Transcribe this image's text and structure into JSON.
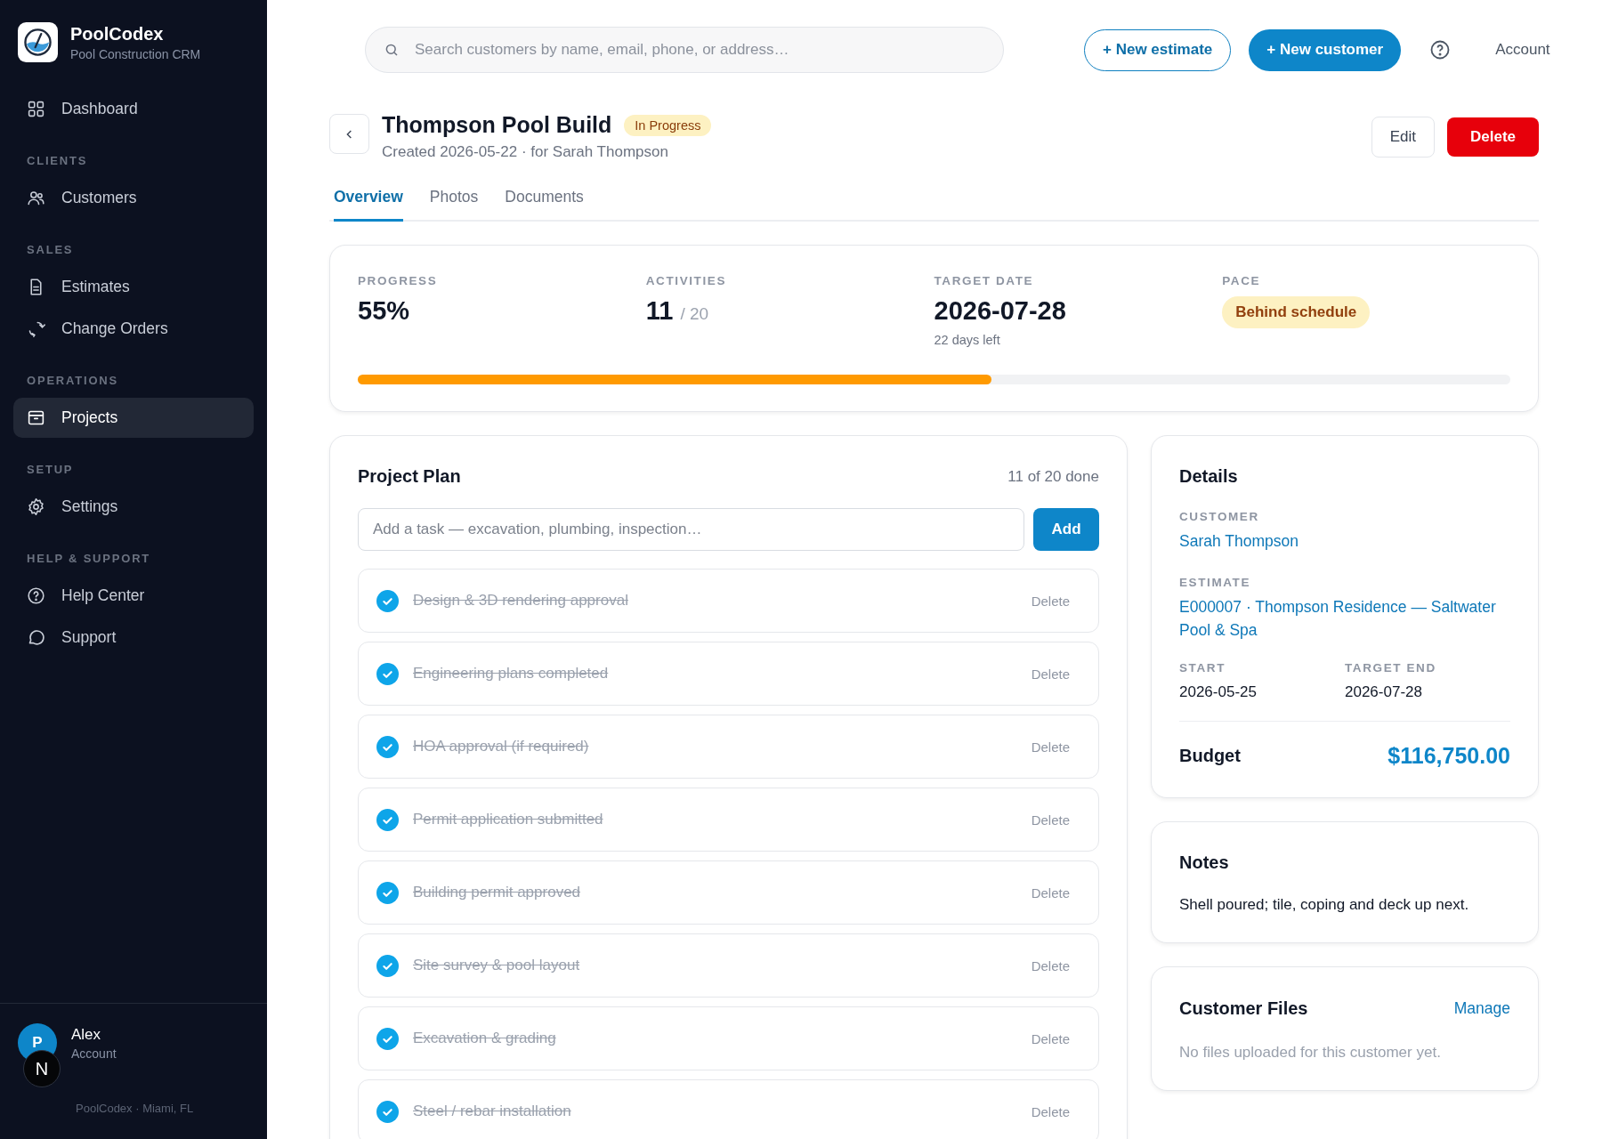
{
  "brand": {
    "name": "PoolCodex",
    "subtitle": "Pool Construction CRM"
  },
  "sidebar": {
    "sections": [
      {
        "items": [
          {
            "label": "Dashboard",
            "selected": false
          }
        ]
      },
      {
        "heading": "CLIENTS",
        "items": [
          {
            "label": "Customers",
            "selected": false
          }
        ]
      },
      {
        "heading": "SALES",
        "items": [
          {
            "label": "Estimates",
            "selected": false
          },
          {
            "label": "Change Orders",
            "selected": false
          }
        ]
      },
      {
        "heading": "OPERATIONS",
        "items": [
          {
            "label": "Projects",
            "selected": true
          }
        ]
      },
      {
        "heading": "SETUP",
        "items": [
          {
            "label": "Settings",
            "selected": false
          }
        ]
      },
      {
        "heading": "HELP & SUPPORT",
        "items": [
          {
            "label": "Help Center",
            "selected": false
          },
          {
            "label": "Support",
            "selected": false
          }
        ]
      }
    ],
    "user": {
      "initial": "P",
      "name": "Alex",
      "role": "Account"
    },
    "footer": "PoolCodex · Miami, FL",
    "dev_badge": "N"
  },
  "topbar": {
    "search": {
      "placeholder": "Search customers by name, email, phone, or address…"
    },
    "new_estimate": "+ New estimate",
    "new_customer": "+ New customer",
    "account": "Account"
  },
  "project": {
    "title": "Thompson Pool Build",
    "status": "In Progress",
    "meta": "Created 2026-05-22 · for Sarah Thompson",
    "edit": "Edit",
    "delete": "Delete"
  },
  "tabs": [
    {
      "label": "Overview",
      "selected": true
    },
    {
      "label": "Photos",
      "selected": false
    },
    {
      "label": "Documents",
      "selected": false
    }
  ],
  "stats": {
    "progress_label": "PROGRESS",
    "progress": "55%",
    "activities_label": "ACTIVITIES",
    "activities_done": "11",
    "activities_total": "/ 20",
    "target_label": "TARGET DATE",
    "target": "2026-07-28",
    "days_left": "22 days left",
    "pace_label": "PACE",
    "pace": "Behind schedule",
    "level": 0.55
  },
  "plan": {
    "title": "Project Plan",
    "count": "11 of 20 done",
    "input": {
      "placeholder": "Add a task — excavation, plumbing, inspection…"
    },
    "add": "Add",
    "tasks": [
      {
        "label": "Design & 3D rendering approval",
        "done": true,
        "delete": "Delete"
      },
      {
        "label": "Engineering plans completed",
        "done": true,
        "delete": "Delete"
      },
      {
        "label": "HOA approval (if required)",
        "done": true,
        "delete": "Delete"
      },
      {
        "label": "Permit application submitted",
        "done": true,
        "delete": "Delete"
      },
      {
        "label": "Building permit approved",
        "done": true,
        "delete": "Delete"
      },
      {
        "label": "Site survey & pool layout",
        "done": true,
        "delete": "Delete"
      },
      {
        "label": "Excavation & grading",
        "done": true,
        "delete": "Delete"
      },
      {
        "label": "Steel / rebar installation",
        "done": true,
        "delete": "Delete"
      }
    ]
  },
  "details": {
    "title": "Details",
    "customer_label": "CUSTOMER",
    "customer": "Sarah Thompson",
    "estimate_label": "ESTIMATE",
    "estimate": "E000007 · Thompson Residence — Saltwater Pool & Spa",
    "start_label": "START",
    "start": "2026-05-25",
    "end_label": "TARGET END",
    "end": "2026-07-28",
    "budget_label": "Budget",
    "budget": "$116,750.00"
  },
  "notes": {
    "title": "Notes",
    "text": "Shell poured; tile, coping and deck up next."
  },
  "files": {
    "title": "Customer Files",
    "manage": "Manage",
    "empty": "No files uploaded for this customer yet."
  }
}
